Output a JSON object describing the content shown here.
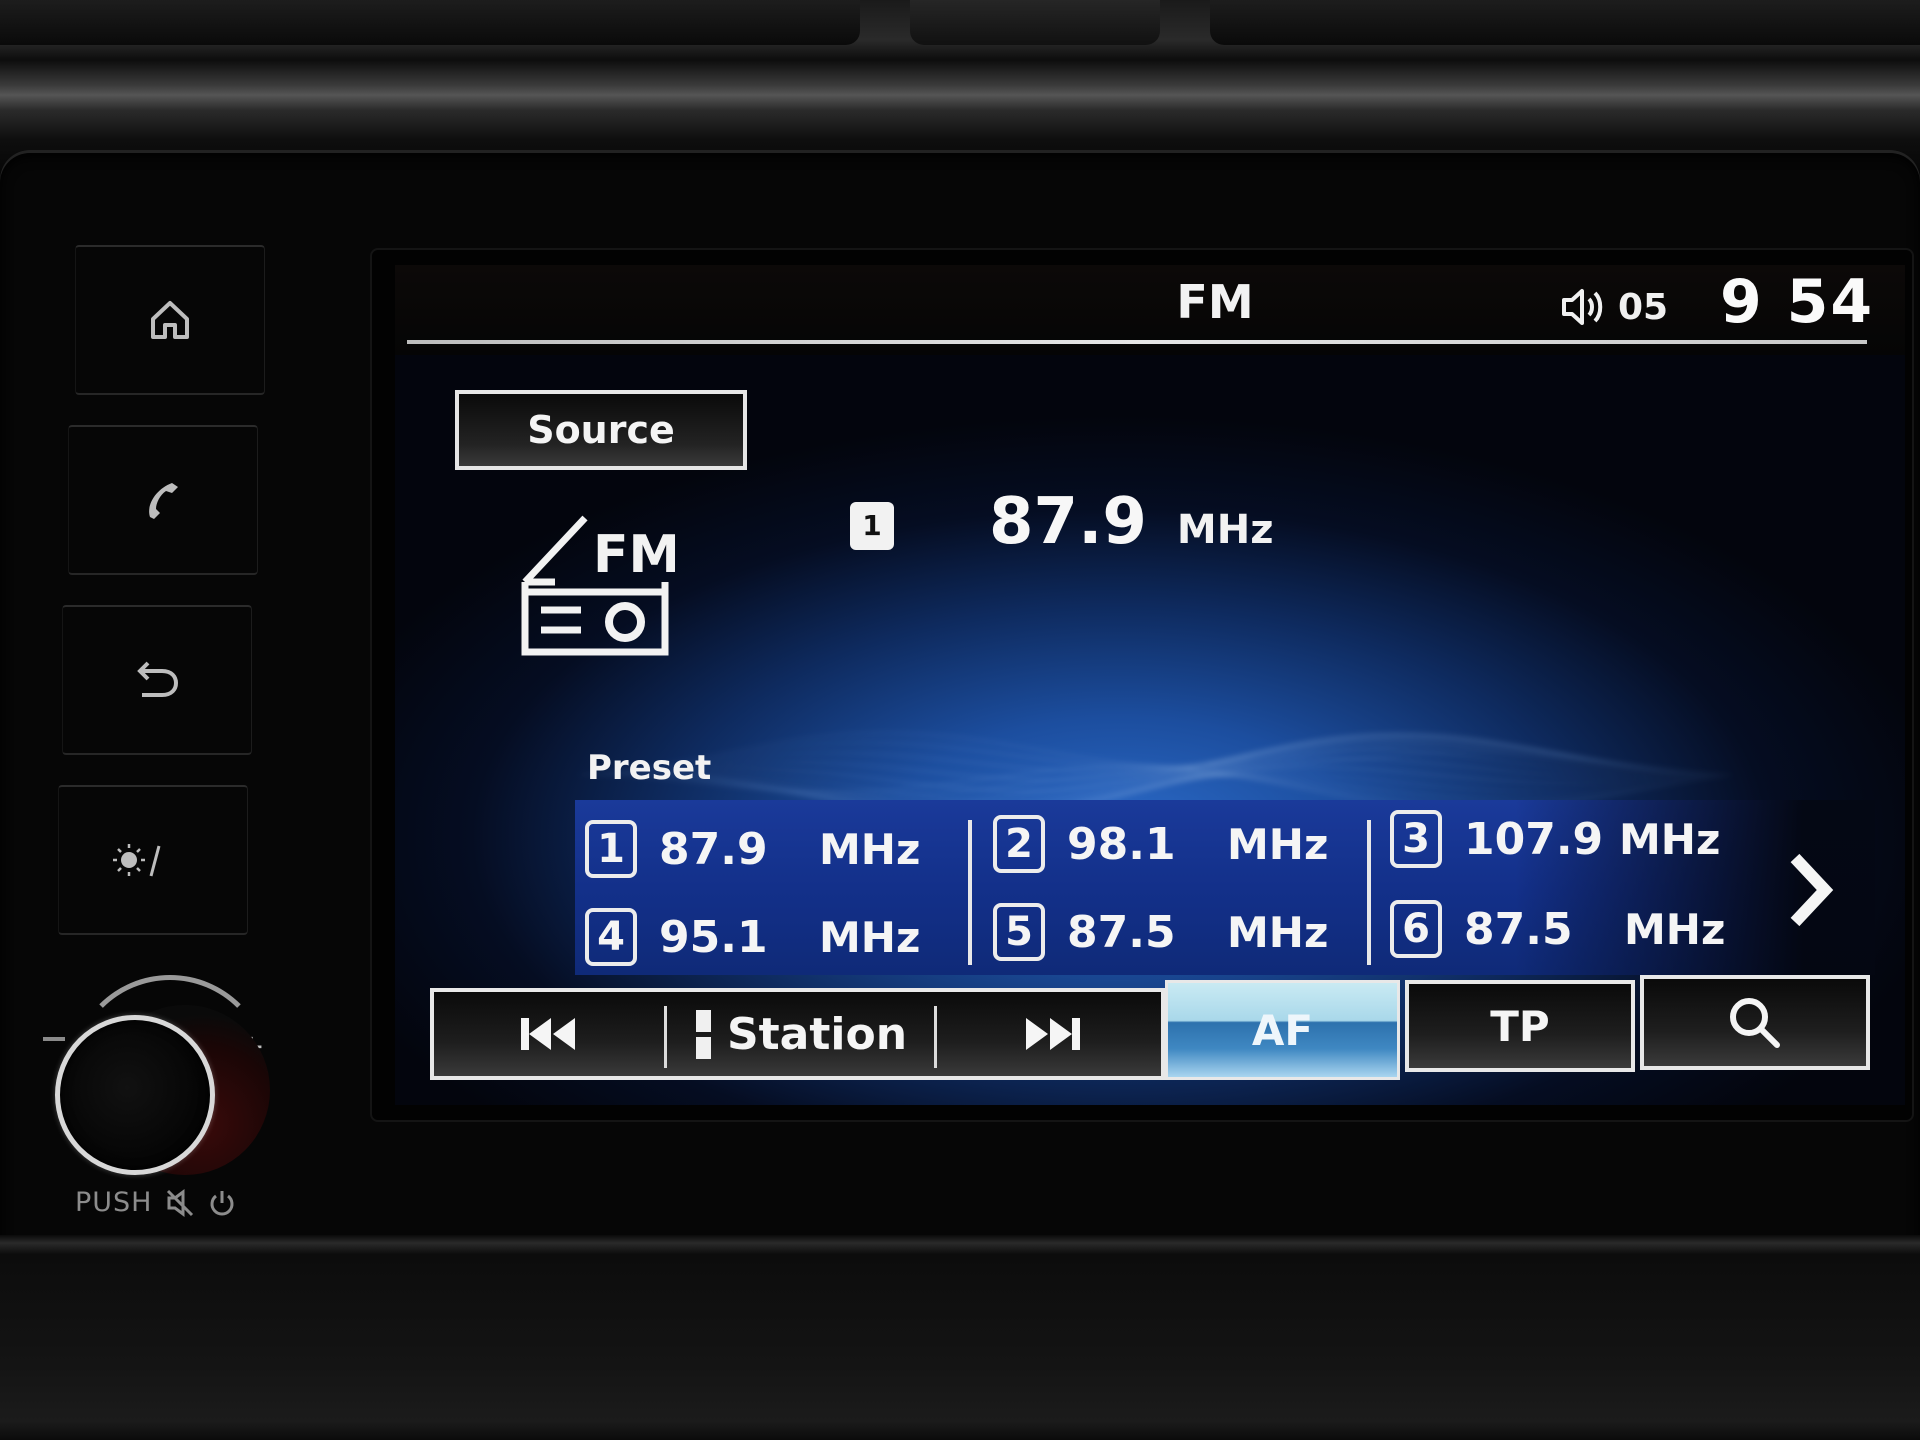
{
  "status_bar": {
    "source_title": "FM",
    "volume_icon": "speaker-volume-icon",
    "volume_level": "05",
    "clock": "9 54"
  },
  "source_button": {
    "label": "Source"
  },
  "band_icon": {
    "icon": "fm-radio-icon",
    "label": "FM"
  },
  "now_playing": {
    "preset_badge": "1",
    "frequency": "87.9",
    "unit": "MHz"
  },
  "presets": {
    "label": "Preset",
    "items": [
      {
        "number": "1",
        "frequency": "87.9",
        "unit": "MHz"
      },
      {
        "number": "2",
        "frequency": "98.1",
        "unit": "MHz"
      },
      {
        "number": "3",
        "frequency": "107.9",
        "unit": "MHz"
      },
      {
        "number": "4",
        "frequency": "95.1",
        "unit": "MHz"
      },
      {
        "number": "5",
        "frequency": "87.5",
        "unit": "MHz"
      },
      {
        "number": "6",
        "frequency": "87.5",
        "unit": "MHz"
      }
    ],
    "next_page_icon": "chevron-right-icon"
  },
  "control_bar": {
    "prev_icon": "skip-back-icon",
    "station_label": "Station",
    "next_icon": "skip-forward-icon",
    "af_label": "AF",
    "af_active": true,
    "tp_label": "TP",
    "search_icon": "search-icon"
  },
  "hardkeys": {
    "home_icon": "home-icon",
    "phone_icon": "phone-icon",
    "back_icon": "back-icon",
    "day_night_icon": "day-night-icon"
  },
  "volume_knob": {
    "minus": "−",
    "plus": "+",
    "push_label": "PUSH",
    "mute_icon": "mute-icon",
    "power_icon": "power-icon"
  }
}
